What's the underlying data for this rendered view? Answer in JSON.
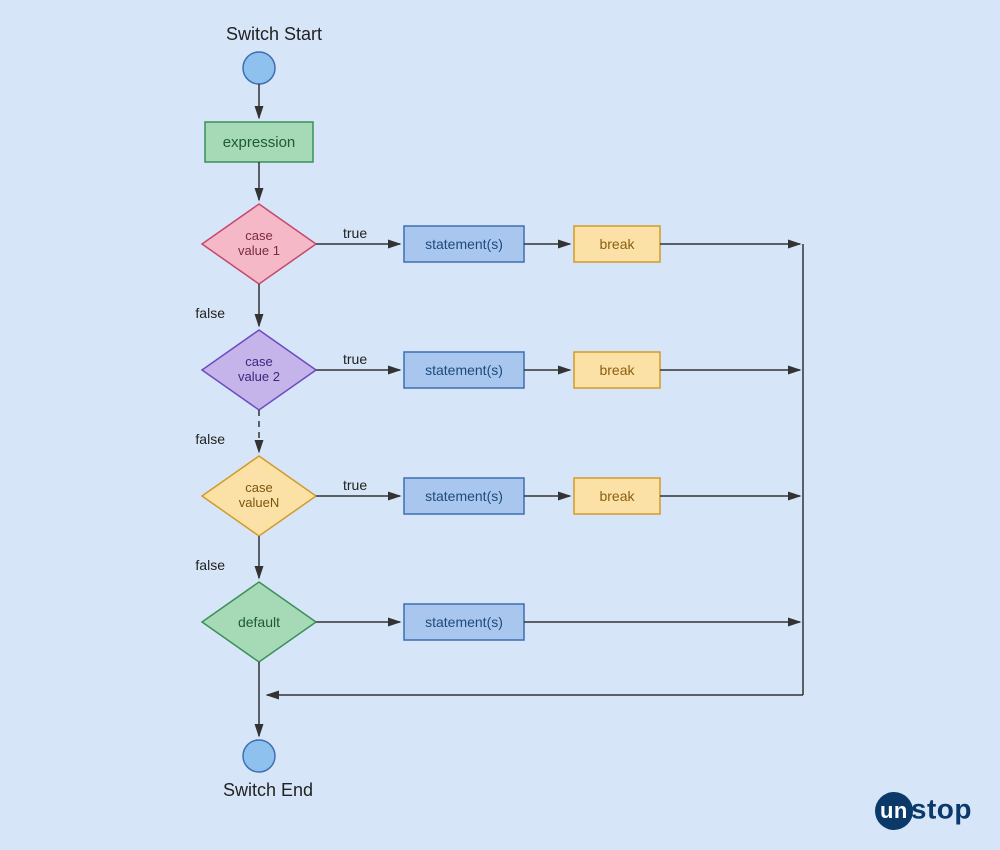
{
  "title_start": "Switch Start",
  "title_end": "Switch End",
  "expression_label": "expression",
  "case1_label": "case\nvalue 1",
  "case2_label": "case\nvalue 2",
  "caseN_label": "case\nvalueN",
  "default_label": "default",
  "stmt_label": "statement(s)",
  "break_label": "break",
  "true_label": "true",
  "false_label": "false",
  "logo_prefix": "un",
  "logo_suffix": "stop",
  "colors": {
    "bg": "#d6e6f8",
    "green_fill": "#a6d9b5",
    "green_stroke": "#3a8f5a",
    "pink_fill": "#f5b8c6",
    "pink_stroke": "#c7476d",
    "purple_fill": "#c5b4ea",
    "purple_stroke": "#6c4ac2",
    "yellow_fill": "#fbe1a5",
    "yellow_stroke": "#d39a2a",
    "blue_fill": "#a9c7ee",
    "blue_stroke": "#3d6fb0",
    "circle_fill": "#8fc1ef",
    "circle_stroke": "#3d6fb0",
    "arrow": "#333333"
  }
}
